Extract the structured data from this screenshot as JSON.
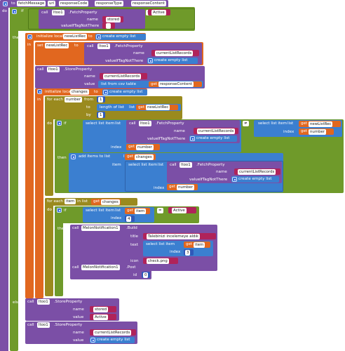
{
  "event": {
    "prefix": "to",
    "name": "fetchMessage",
    "params": [
      "uri",
      "responseCode",
      "responseType",
      "responseContent"
    ]
  },
  "do_label": "do",
  "if_label": "if",
  "then_label": "then",
  "else_label": "else",
  "call_label": "call",
  "name_label": "name",
  "valueIfTagNotThere_label": "valueIfTagNotThere",
  "value_label": "value",
  "in_label": "in",
  "to_label": "to",
  "get_label": "get",
  "set_label": "set",
  "list_label": "list",
  "index_label": "index",
  "item_label": "item",
  "fetch": {
    "component": "ltoo1",
    "method": ".FetchProperty",
    "name": "stored",
    "valueIfTagNotThere": "",
    "compare_value": "Active",
    "compare_op": "="
  },
  "init1": {
    "label": "initialize local",
    "var": "newListRec",
    "to": "to",
    "create": "create empty list"
  },
  "set1": {
    "var": "newListRec",
    "to": "to",
    "component": "ltoo1",
    "method": ".FetchProperty",
    "name": "currentListRecords",
    "create": "create empty list"
  },
  "store1": {
    "component": "ltoo1",
    "method": ".StoreProperty",
    "name": "currentListRecords",
    "value_prefix": "list from csv table",
    "text_label": "text",
    "value_get": "responseContent"
  },
  "init2": {
    "label": "initialize local",
    "var": "changes",
    "to": "to",
    "create": "create empty list"
  },
  "foreach1": {
    "label": "for each",
    "var": "number",
    "from_label": "from",
    "from": "1",
    "to_label": "to",
    "len_label": "length of list",
    "len_list_label": "list",
    "len_get": "newListRec",
    "by_label": "by",
    "by": "1"
  },
  "if2": {
    "select_label": "select list item",
    "list_label": "list",
    "component": "ltoo1",
    "method": ".FetchProperty",
    "name": "currentListRecords",
    "create": "create empty list",
    "index_get": "number",
    "op": "≠",
    "rhs_select": "select list item",
    "rhs_list_get": "newListRec",
    "rhs_index_get": "number"
  },
  "add": {
    "label": "add items to list",
    "list_label": "list",
    "list_get": "changes",
    "item_label": "item",
    "select": "select list item",
    "select_list": "list",
    "component": "ltoo1",
    "method": ".FetchProperty",
    "name": "currentListRecords",
    "create": "create empty list",
    "index_get": "number"
  },
  "foreach2": {
    "label": "for each",
    "var": "item",
    "in_label": "in list",
    "get": "changes"
  },
  "if3": {
    "select": "select list item",
    "list_label": "list",
    "list_get": "item",
    "index": "4",
    "op": "=",
    "value": "Active"
  },
  "notif": {
    "component": "MelonNotification1",
    "method": ".Build",
    "title_label": "title",
    "title": "Talebinizi incelemeye aldık",
    "text_label": "text",
    "text_select": "select list item",
    "text_list_get": "item",
    "text_index": "3",
    "icon_label": "icon",
    "icon": "check.png",
    "post_method": ".Post",
    "id_label": "id",
    "id": "0"
  },
  "else1": {
    "component": "ltoo1",
    "method": ".StoreProperty",
    "name": "stored",
    "value": "Active"
  },
  "else2": {
    "component": "ltoo1",
    "method": ".StoreProperty",
    "name": "currentListRecords",
    "create": "create empty list"
  },
  "colors": {
    "procedure": "#7b4fa6",
    "logic": "#6f9a2a",
    "variable": "#e1671f",
    "component": "#7b4fa6",
    "text": "#b0235a",
    "list": "#3b7fd0",
    "control": "#9a8a1e",
    "math": "#2f59b9"
  }
}
